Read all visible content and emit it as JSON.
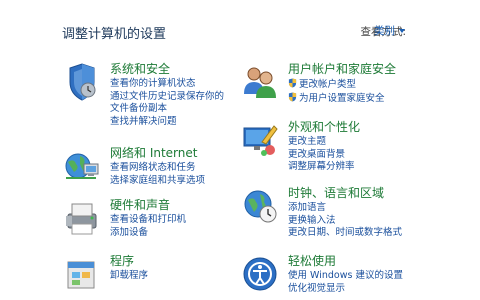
{
  "header": {
    "title": "调整计算机的设置",
    "view_by_label": "查看方式:",
    "view_by_value": "类别"
  },
  "categories": [
    {
      "title": "系统和安全",
      "links": [
        "查看你的计算机状态",
        "通过文件历史记录保存你的",
        "文件备份副本",
        "查找并解决问题"
      ]
    },
    {
      "title": "网络和 Internet",
      "links": [
        "查看网络状态和任务",
        "选择家庭组和共享选项"
      ]
    },
    {
      "title": "硬件和声音",
      "links": [
        "查看设备和打印机",
        "添加设备"
      ]
    },
    {
      "title": "程序",
      "links": [
        "卸载程序"
      ]
    },
    {
      "title": "用户帐户和家庭安全",
      "links": [
        "更改帐户类型",
        "为用户设置家庭安全"
      ]
    },
    {
      "title": "外观和个性化",
      "links": [
        "更改主题",
        "更改桌面背景",
        "调整屏幕分辨率"
      ]
    },
    {
      "title": "时钟、语言和区域",
      "links": [
        "添加语言",
        "更换输入法",
        "更改日期、时间或数字格式"
      ]
    },
    {
      "title": "轻松使用",
      "links": [
        "使用 Windows 建议的设置",
        "优化视觉显示"
      ]
    }
  ]
}
